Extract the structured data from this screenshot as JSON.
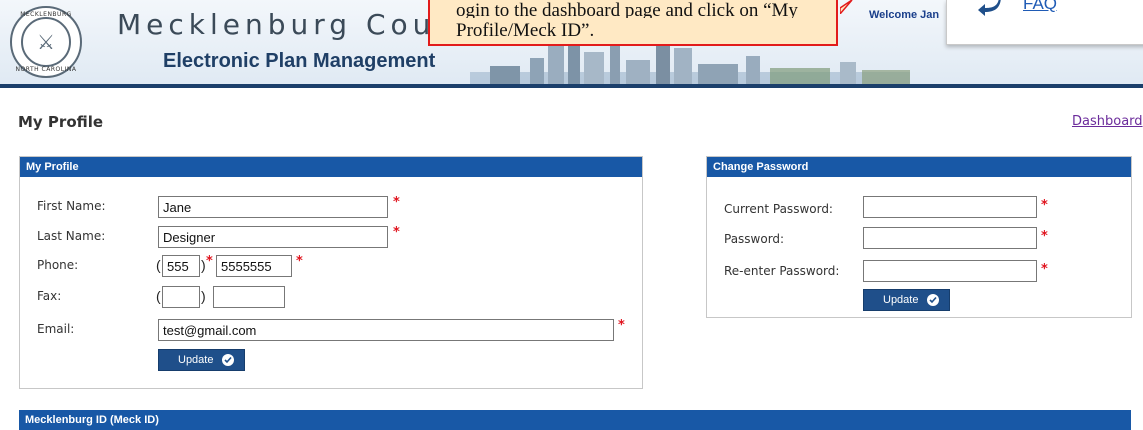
{
  "header": {
    "seal_text_top": "MECKLENBURG",
    "seal_text_bottom": "NORTH CAROLINA",
    "county_title": "Mecklenburg County",
    "subtitle": "Electronic Plan Management",
    "welcome_text": "Welcome Jan",
    "callout_line1": "ogin to the dashboard page and click on “My",
    "callout_line2": "Profile/Meck ID”.",
    "faq_label": "FAQ"
  },
  "page": {
    "title": "My Profile",
    "dashboard_link": "Dashboard"
  },
  "profile_panel": {
    "header": "My Profile",
    "first_name_label": "First Name:",
    "first_name_value": "Jane",
    "last_name_label": "Last Name:",
    "last_name_value": "Designer",
    "phone_label": "Phone:",
    "phone_area": "555",
    "phone_number": "5555555",
    "fax_label": "Fax:",
    "fax_area": "",
    "fax_number": "",
    "email_label": "Email:",
    "email_value": "test@gmail.com",
    "update_label": "Update",
    "paren_open": "(",
    "paren_close": ")"
  },
  "password_panel": {
    "header": "Change Password",
    "current_label": "Current Password:",
    "password_label": "Password:",
    "reenter_label": "Re-enter Password:",
    "update_label": "Update"
  },
  "meck_id": {
    "header": "Mecklenburg ID (Meck ID)"
  },
  "required_marker": "*",
  "colors": {
    "panel_header": "#1858a6",
    "button": "#1f4f8a",
    "required": "#e0141e",
    "callout_bg": "#ffe9c4",
    "callout_border": "#e21b1b"
  }
}
